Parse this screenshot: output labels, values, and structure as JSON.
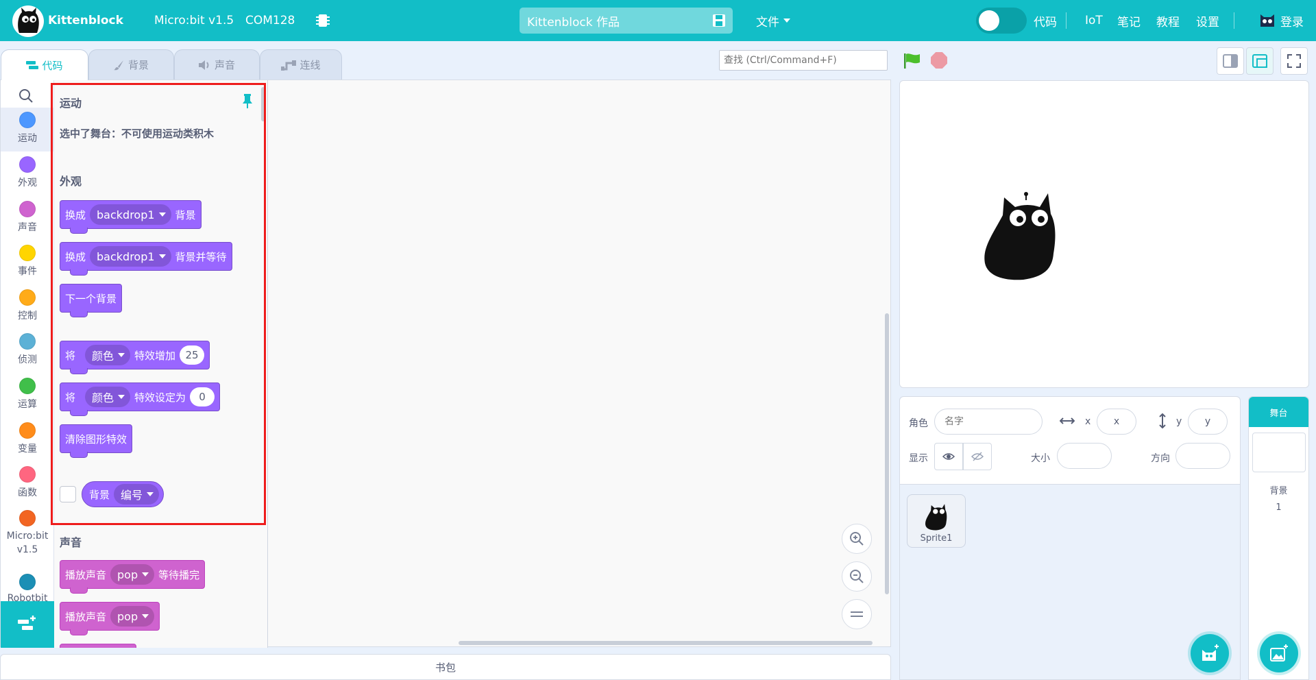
{
  "header": {
    "brand": "Kittenblock",
    "device": "Micro:bit v1.5",
    "port": "COM128",
    "project_title": "Kittenblock 作品",
    "file_menu": "文件",
    "mode_label": "代码",
    "nav": [
      "IoT",
      "笔记",
      "教程",
      "设置"
    ],
    "login": "登录"
  },
  "tabs": [
    {
      "label": "代码",
      "icon": "code-icon",
      "active": true
    },
    {
      "label": "背景",
      "icon": "brush-icon",
      "active": false
    },
    {
      "label": "声音",
      "icon": "speaker-icon",
      "active": false
    },
    {
      "label": "连线",
      "icon": "wire-icon",
      "active": false
    }
  ],
  "search": {
    "placeholder": "查找 (Ctrl/Command+F)"
  },
  "categories": [
    {
      "label": "运动",
      "color": "#4c97ff",
      "selected": true
    },
    {
      "label": "外观",
      "color": "#9966ff"
    },
    {
      "label": "声音",
      "color": "#cf63cf"
    },
    {
      "label": "事件",
      "color": "#ffd500"
    },
    {
      "label": "控制",
      "color": "#ffab19"
    },
    {
      "label": "侦测",
      "color": "#5cb1d6"
    },
    {
      "label": "运算",
      "color": "#40bf4a"
    },
    {
      "label": "变量",
      "color": "#ff8c1a"
    },
    {
      "label": "函数",
      "color": "#ff6680"
    },
    {
      "label": "Micro:bit v1.5",
      "color": "#f26522"
    },
    {
      "label": "Robotbit",
      "color": "#1c8fb5"
    }
  ],
  "flyout": {
    "motion_title": "运动",
    "motion_note": "选中了舞台：不可使用运动类积木",
    "looks_title": "外观",
    "looks_blocks": {
      "switch_backdrop": {
        "pre": "换成",
        "menu": "backdrop1",
        "post": "背景"
      },
      "switch_backdrop_wait": {
        "pre": "换成",
        "menu": "backdrop1",
        "post": "背景并等待"
      },
      "next_backdrop": "下一个背景",
      "change_effect": {
        "pre": "将",
        "menu": "颜色",
        "mid": "特效增加",
        "value": "25"
      },
      "set_effect": {
        "pre": "将",
        "menu": "颜色",
        "mid": "特效设定为",
        "value": "0"
      },
      "clear_effects": "清除图形特效",
      "backdrop_reporter": {
        "label": "背景",
        "menu": "编号"
      }
    },
    "sound_title": "声音",
    "sound_blocks": {
      "play_until_done": {
        "pre": "播放声音",
        "menu": "pop",
        "post": "等待播完"
      },
      "start_sound": {
        "pre": "播放声音",
        "menu": "pop"
      }
    }
  },
  "backpack": "书包",
  "sprite_info": {
    "sprite_label": "角色",
    "name_placeholder": "名字",
    "x_label": "x",
    "x_placeholder": "x",
    "y_label": "y",
    "y_placeholder": "y",
    "show_label": "显示",
    "size_label": "大小",
    "direction_label": "方向"
  },
  "sprites": [
    {
      "name": "Sprite1"
    }
  ],
  "stage_panel": {
    "title": "舞台",
    "backdrop_label": "背景",
    "backdrop_count": "1"
  }
}
